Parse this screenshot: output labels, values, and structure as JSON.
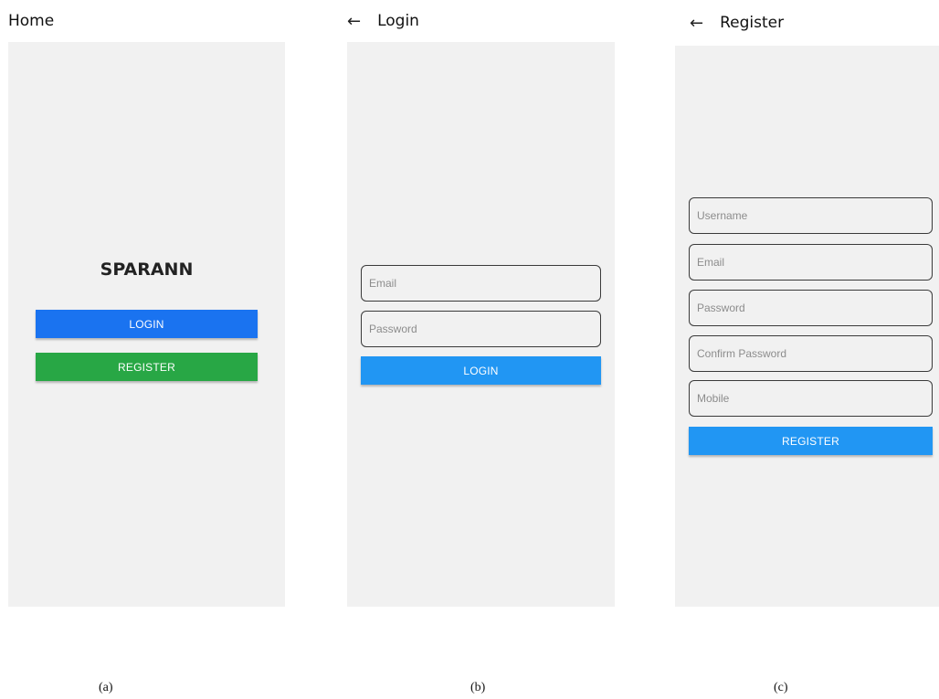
{
  "home": {
    "title": "Home",
    "app_name": "SPARANN",
    "login_label": "LOGIN",
    "register_label": "REGISTER",
    "caption": "(a)"
  },
  "login": {
    "back_icon": "←",
    "title": "Login",
    "email_placeholder": "Email",
    "password_placeholder": "Password",
    "login_label": "LOGIN",
    "caption": "(b)"
  },
  "register": {
    "back_icon": "←",
    "title": "Register",
    "username_placeholder": "Username",
    "email_placeholder": "Email",
    "password_placeholder": "Password",
    "confirm_password_placeholder": "Confirm Password",
    "mobile_placeholder": "Mobile",
    "register_label": "REGISTER",
    "caption": "(c)"
  },
  "colors": {
    "primary_blue": "#1a73f0",
    "success_green": "#28a745",
    "light_blue": "#2196f3",
    "screen_background": "#f1f1f1"
  }
}
